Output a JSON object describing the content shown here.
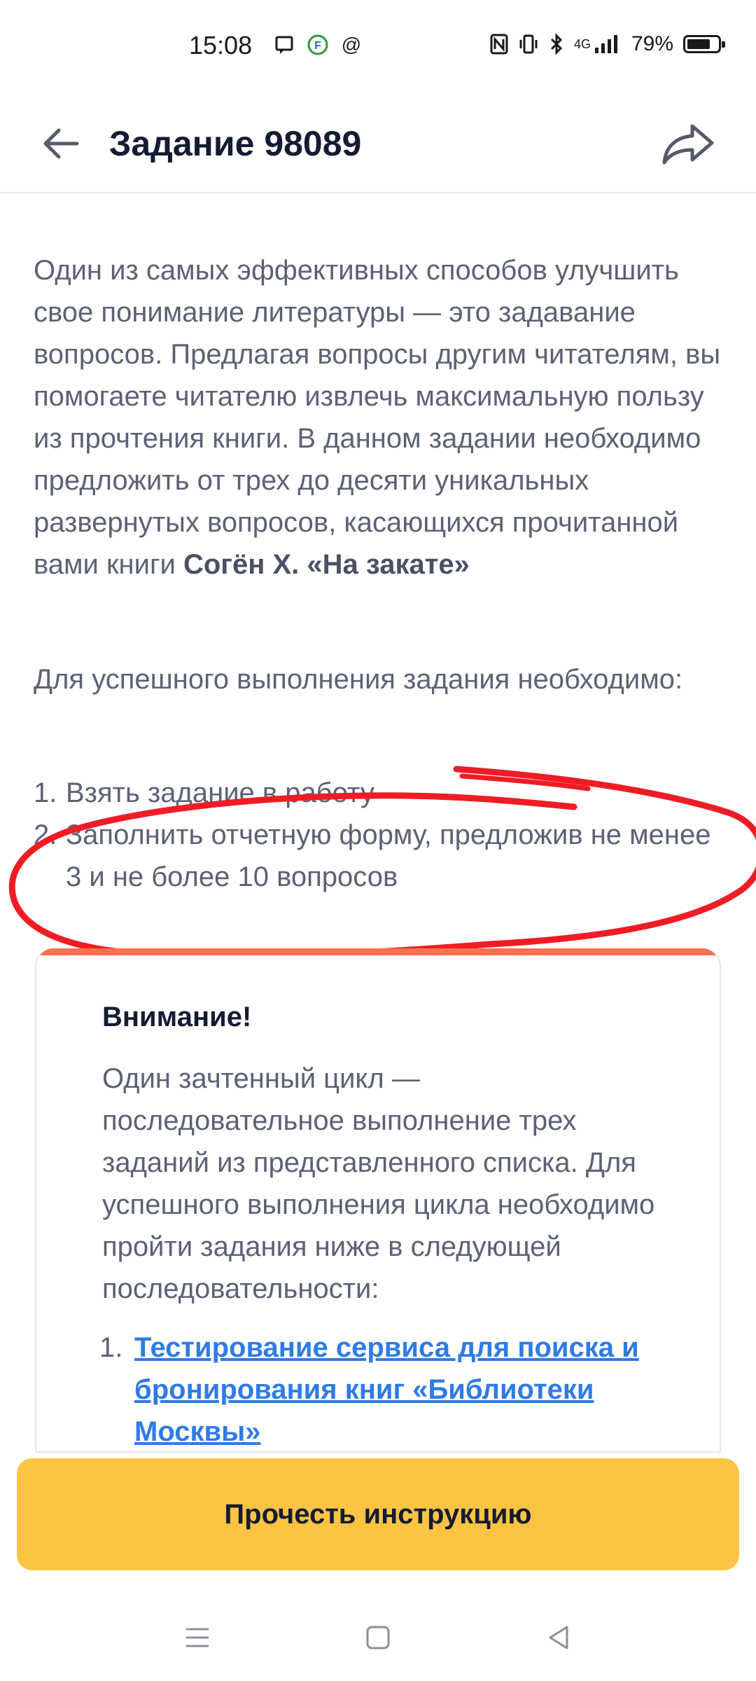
{
  "status_bar": {
    "time": "15:08",
    "battery_percent": "79%",
    "network": "4G",
    "battery_level": 0.79,
    "icons": [
      "message-icon",
      "f-app-icon",
      "at-icon",
      "nfc-icon",
      "vibrate-icon",
      "bluetooth-icon",
      "signal-icon",
      "battery-icon"
    ]
  },
  "header": {
    "title": "Задание 98089"
  },
  "content": {
    "para1_text": "Один из самых эффективных способов улучшить свое понимание литературы — это задавание вопросов. Предлагая вопросы другим читателям, вы помогаете читателю извлечь максимальную пользу из прочтения книги.  В данном задании необходимо предложить от трех до десяти уникальных развернутых вопросов, касающихся прочитанной вами книги ",
    "para1_book": "Согён Х. «На закате»",
    "para2": "Для успешного выполнения задания необходимо:",
    "steps": [
      {
        "num": "1.",
        "text": "Взять задание в работу"
      },
      {
        "num": "2.",
        "text": "Заполнить отчетную форму, предложив не менее 3 и не более 10 вопросов"
      }
    ]
  },
  "attention": {
    "title": "Внимание!",
    "text": "Один зачтенный цикл — последовательное выполнение трех заданий из представленного списка. Для успешного выполнения цикла необходимо пройти задания ниже в следующей последовательности:",
    "links": [
      {
        "num": "1.",
        "text": "Тестирование сервиса для поиска и бронирования книг «Библиотеки Москвы»"
      }
    ]
  },
  "cta": {
    "label": "Прочесть инструкцию"
  },
  "colors": {
    "accent_button": "#fdc443",
    "card_top_border": "#ff6f4f",
    "link": "#2f7be5",
    "annotation_red": "#ee1c25"
  }
}
